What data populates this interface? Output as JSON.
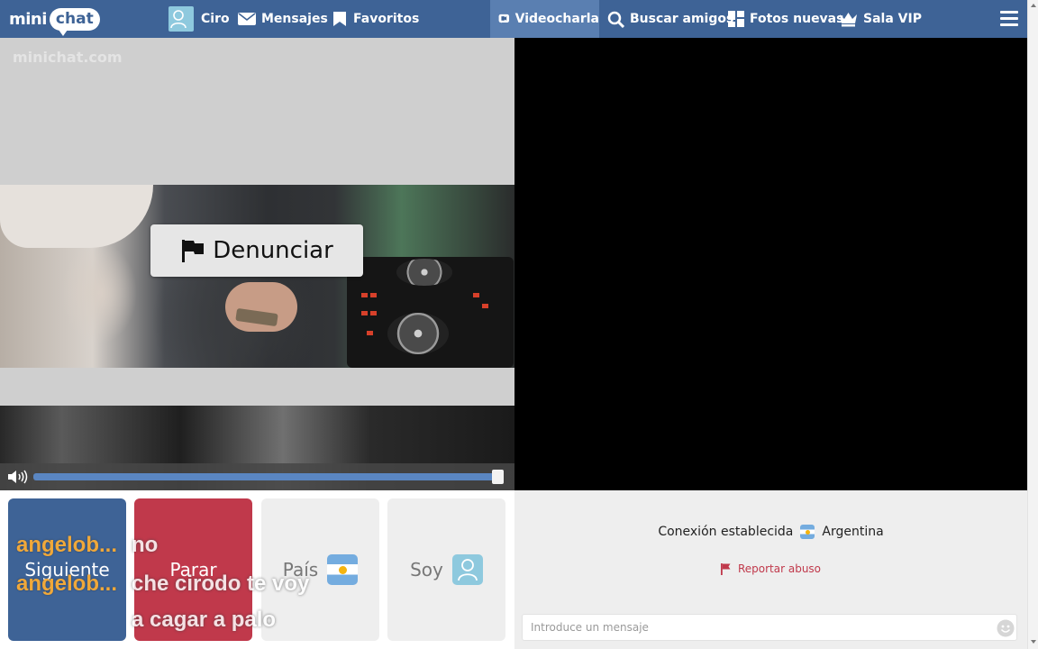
{
  "header": {
    "logo_part1": "mini",
    "logo_part2": "chat",
    "user_name": "Ciro",
    "nav_left": [
      "Mensajes",
      "Favoritos"
    ],
    "nav_right": [
      "Videocharla",
      "Buscar amigos",
      "Fotos nuevas",
      "Sala VIP"
    ],
    "active_tab": "Videocharla"
  },
  "video_left": {
    "watermark": "minichat.com",
    "report_button": "Denunciar",
    "volume_level": 1.0
  },
  "controls": {
    "next_label": "Siguiente",
    "stop_label": "Parar",
    "country_label": "País",
    "gender_label": "Soy"
  },
  "chat": {
    "connection_status": "Conexión establecida",
    "country": "Argentina",
    "report_abuse": "Reportar abuso",
    "input_placeholder": "Introduce un mensaje",
    "input_value": ""
  },
  "subtitles": {
    "line1_user": "angelob...",
    "line1_text": "no",
    "line2_user": "angelob...",
    "line2_text": "che cirodo te voy",
    "line3_text": "a cagar a palo"
  },
  "colors": {
    "topbar": "#3e6396",
    "active_tab": "#5a7fb1",
    "next_button": "#3e6396",
    "stop_button": "#c0394b",
    "report_link": "#c0394b"
  }
}
